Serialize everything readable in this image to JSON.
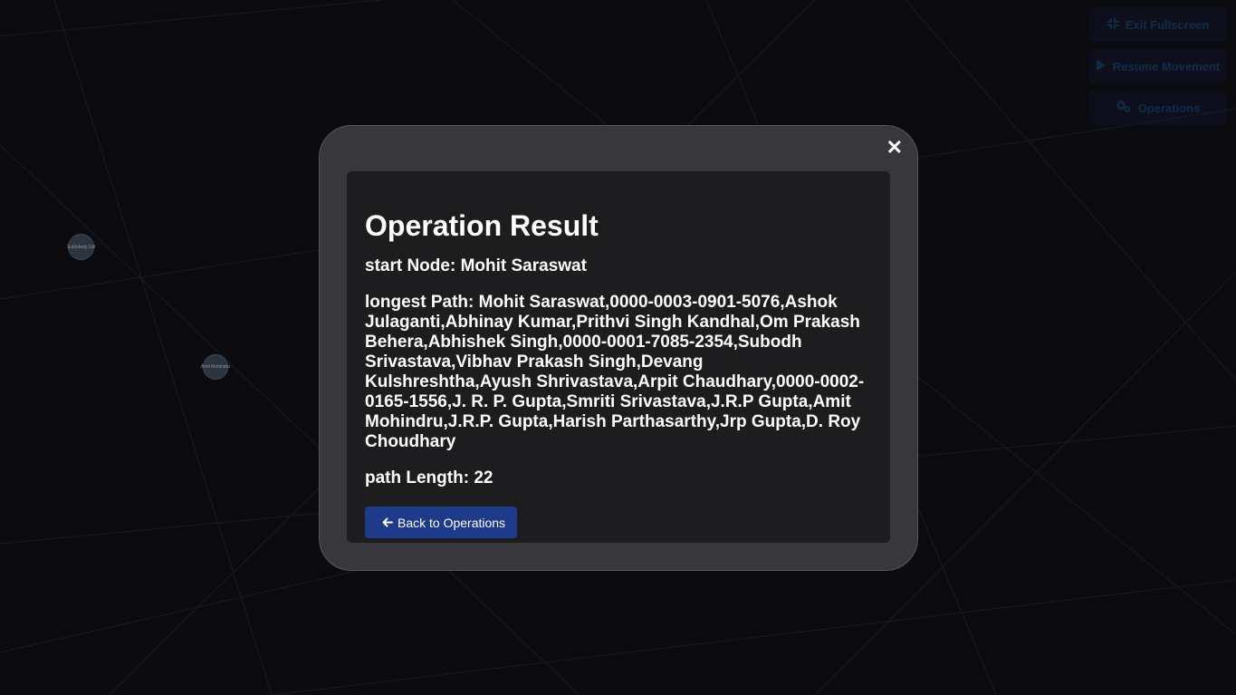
{
  "controls": {
    "exit_fullscreen": "Exit Fullscreen",
    "resume_movement": "Resume Movement",
    "operations": "Operations"
  },
  "icons": {
    "compress": "compress-icon",
    "play": "play-icon",
    "gears": "gears-icon",
    "close": "close-icon",
    "arrow_left": "arrow-left-icon"
  },
  "graph": {
    "nodes": [
      {
        "label": "Sukhdeep Gill"
      },
      {
        "label": "Amit Mohindru"
      }
    ]
  },
  "modal": {
    "close_symbol": "✕",
    "title": "Operation Result",
    "start_node_label": "start Node:",
    "start_node_value": "Mohit Saraswat",
    "longest_path_label": "longest Path:",
    "longest_path_value": "Mohit Saraswat,0000-0003-0901-5076,Ashok Julaganti,Abhinay Kumar,Prithvi Singh Kandhal,Om Prakash Behera,Abhishek Singh,0000-0001-7085-2354,Subodh Srivastava,Vibhav Prakash Singh,Devang Kulshreshtha,Ayush Shrivastava,Arpit Chaudhary,0000-0002-0165-1556,J. R. P. Gupta,Smriti Srivastava,J.R.P Gupta,Amit Mohindru,J.R.P. Gupta,Harish Parthasarthy,Jrp Gupta,D. Roy Choudhary",
    "path_length_label": "path Length:",
    "path_length_value": "22",
    "back_button": "Back to Operations"
  },
  "colors": {
    "background": "#0b0b10",
    "modal_frame": "#38373c",
    "modal_content": "#1d1d20",
    "button_primary": "#1e3a8a"
  }
}
